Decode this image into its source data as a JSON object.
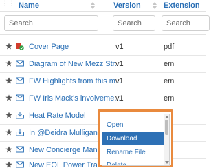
{
  "columns": [
    {
      "label": "Name",
      "filter_placeholder": "Search"
    },
    {
      "label": "Version",
      "filter_placeholder": "Search"
    },
    {
      "label": "Extension",
      "filter_placeholder": "Search"
    }
  ],
  "rows": [
    {
      "icon": "word-checked-icon",
      "name": "Cover Page",
      "version": "v1",
      "extension": "pdf"
    },
    {
      "icon": "envelope-icon",
      "name": "Diagram of New Mezz Str...",
      "version": "v1",
      "extension": "eml"
    },
    {
      "icon": "envelope-icon",
      "name": "FW Highlights from this m...",
      "version": "v1",
      "extension": "eml"
    },
    {
      "icon": "envelope-icon",
      "name": "FW Iris Mack's involveme...",
      "version": "v1",
      "extension": "eml"
    },
    {
      "icon": "tray-download-icon",
      "name": "Heat Rate Model",
      "version": "",
      "extension": ""
    },
    {
      "icon": "tray-download-icon",
      "name": "In @Deidra Mulligan",
      "version": "",
      "extension": ""
    },
    {
      "icon": "envelope-icon",
      "name": "New Concierge Managem",
      "version": "",
      "extension": ""
    },
    {
      "icon": "envelope-icon",
      "name": "New EOL Power Trader ID",
      "version": "",
      "extension": ""
    }
  ],
  "context_menu": {
    "items": [
      "Open",
      "Download",
      "Rename File",
      "Delete"
    ],
    "selected": "Download"
  },
  "colors": {
    "link": "#2a6fb5",
    "highlight_frame": "#e98a3e",
    "selected_bg": "#2d70b5",
    "star": "#555555"
  }
}
